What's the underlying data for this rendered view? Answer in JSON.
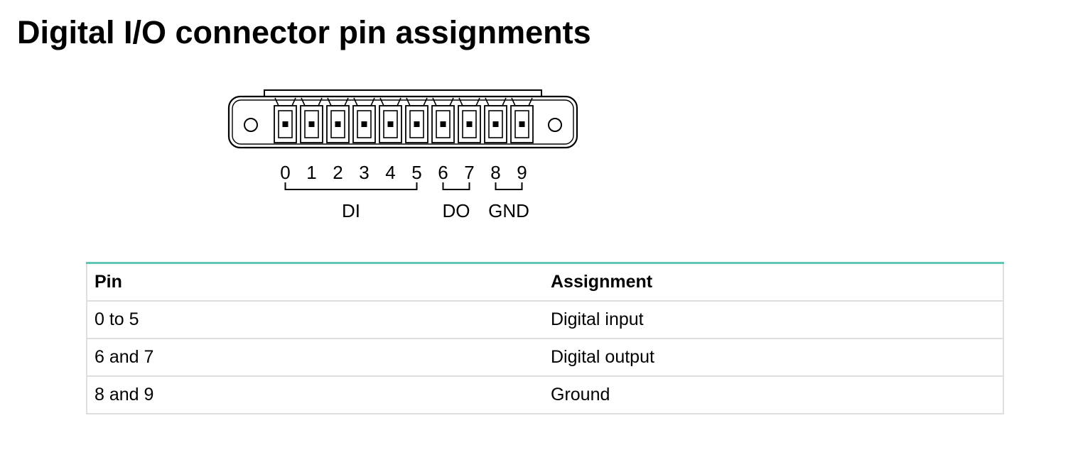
{
  "document": {
    "title": "Digital I/O connector pin assignments"
  },
  "connector_diagram": {
    "pin_labels": [
      "0",
      "1",
      "2",
      "3",
      "4",
      "5",
      "6",
      "7",
      "8",
      "9"
    ],
    "groups": [
      {
        "label": "DI",
        "first_pin": 0,
        "last_pin": 5
      },
      {
        "label": "DO",
        "first_pin": 6,
        "last_pin": 7
      },
      {
        "label": "GND",
        "first_pin": 8,
        "last_pin": 9
      }
    ]
  },
  "pin_table": {
    "headers": [
      "Pin",
      "Assignment"
    ],
    "rows": [
      [
        "0 to 5",
        "Digital input"
      ],
      [
        "6 and 7",
        "Digital output"
      ],
      [
        "8 and 9",
        "Ground"
      ]
    ],
    "accent_color": "#5fc8b4"
  }
}
